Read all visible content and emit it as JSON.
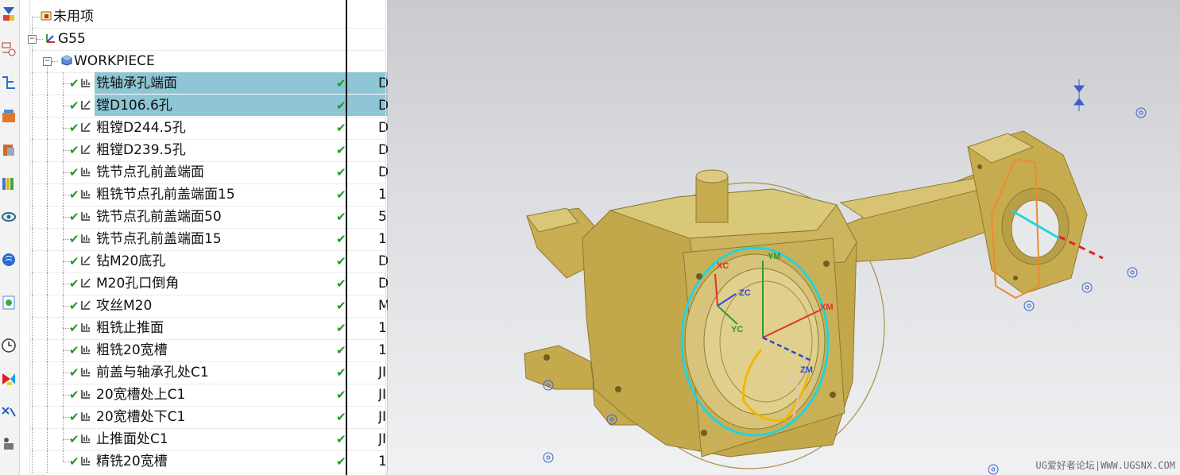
{
  "tree": {
    "rows": [
      {
        "label": "未用项",
        "status": "",
        "extra": ""
      },
      {
        "label": "G55",
        "status": "",
        "extra": ""
      },
      {
        "label": "WORKPIECE",
        "status": "",
        "extra": ""
      },
      {
        "label": "铣轴承孔端面",
        "status": "✔",
        "extra": "D"
      },
      {
        "label": "镗D106.6孔",
        "status": "✔",
        "extra": "D"
      },
      {
        "label": "粗镗D244.5孔",
        "status": "✔",
        "extra": "D"
      },
      {
        "label": "粗镗D239.5孔",
        "status": "✔",
        "extra": "D"
      },
      {
        "label": "铣节点孔前盖端面",
        "status": "✔",
        "extra": "D"
      },
      {
        "label": "粗铣节点孔前盖端面15",
        "status": "✔",
        "extra": "1"
      },
      {
        "label": "铣节点孔前盖端面50",
        "status": "✔",
        "extra": "5"
      },
      {
        "label": "铣节点孔前盖端面15",
        "status": "✔",
        "extra": "1"
      },
      {
        "label": "钻M20底孔",
        "status": "✔",
        "extra": "D"
      },
      {
        "label": "M20孔口倒角",
        "status": "✔",
        "extra": "D"
      },
      {
        "label": "攻丝M20",
        "status": "✔",
        "extra": "M"
      },
      {
        "label": "粗铣止推面",
        "status": "✔",
        "extra": "1"
      },
      {
        "label": "粗铣20宽槽",
        "status": "✔",
        "extra": "1"
      },
      {
        "label": "前盖与轴承孔处C1",
        "status": "✔",
        "extra": "JI"
      },
      {
        "label": "20宽槽处上C1",
        "status": "✔",
        "extra": "JI"
      },
      {
        "label": "20宽槽处下C1",
        "status": "✔",
        "extra": "JI"
      },
      {
        "label": "止推面处C1",
        "status": "✔",
        "extra": "JI"
      },
      {
        "label": "精铣20宽槽",
        "status": "✔",
        "extra": "1"
      }
    ]
  },
  "viewport": {
    "axes": {
      "xc": "XC",
      "yc": "YC",
      "zc": "ZC",
      "xm": "XM",
      "ym": "YM",
      "zm": "ZM"
    },
    "watermark": "UG爱好者论坛|WWW.UGSNX.COM"
  },
  "colors": {
    "selection": "#8ec6d5",
    "check": "#1e9a22",
    "part": "#c9b056",
    "accent": "#22d3e0"
  }
}
